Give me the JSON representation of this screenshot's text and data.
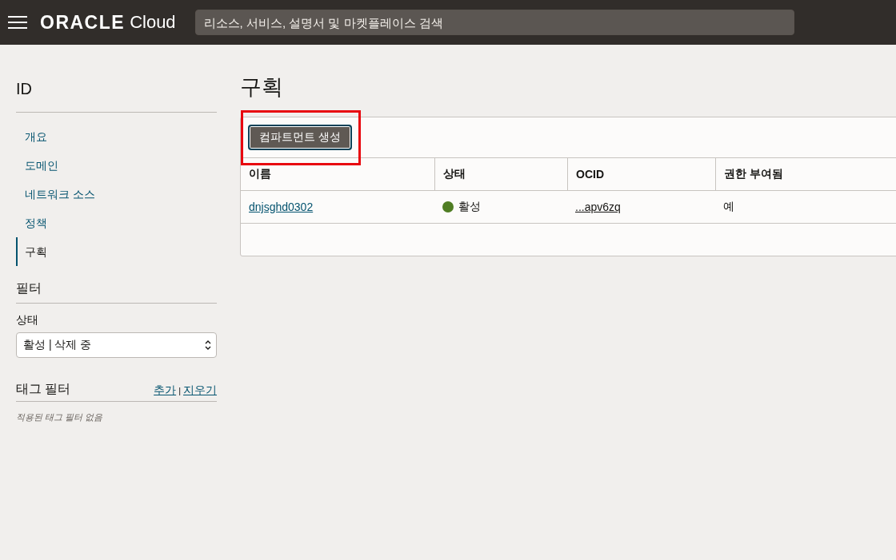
{
  "header": {
    "logo": "ORACLE",
    "logo_suffix": "Cloud",
    "search": {
      "placeholder": "리소스, 서비스, 설명서 및 마켓플레이스 검색"
    }
  },
  "sidebar": {
    "title": "ID",
    "items": [
      {
        "label": "개요",
        "selected": false
      },
      {
        "label": "도메인",
        "selected": false
      },
      {
        "label": "네트워크 소스",
        "selected": false
      },
      {
        "label": "정책",
        "selected": false
      },
      {
        "label": "구획",
        "selected": true
      }
    ],
    "filters_title": "필터",
    "state_label": "상태",
    "state_value": "활성 | 삭제 중",
    "tag_filters_title": "태그 필터",
    "tag_add": "추가",
    "tag_separator": "|",
    "tag_clear": "지우기",
    "tag_empty": "적용된 태그 필터 없음"
  },
  "main": {
    "title": "구획",
    "create_button": {
      "label": "컴파트먼트 생성",
      "highlighted": true
    },
    "table": {
      "columns": [
        "이름",
        "상태",
        "OCID",
        "권한 부여됨"
      ],
      "rows": [
        {
          "name": "dnjsghd0302",
          "state": "활성",
          "color": "#4f7d23",
          "ocid": "...apv6zq",
          "authorized": "예"
        }
      ]
    }
  }
}
